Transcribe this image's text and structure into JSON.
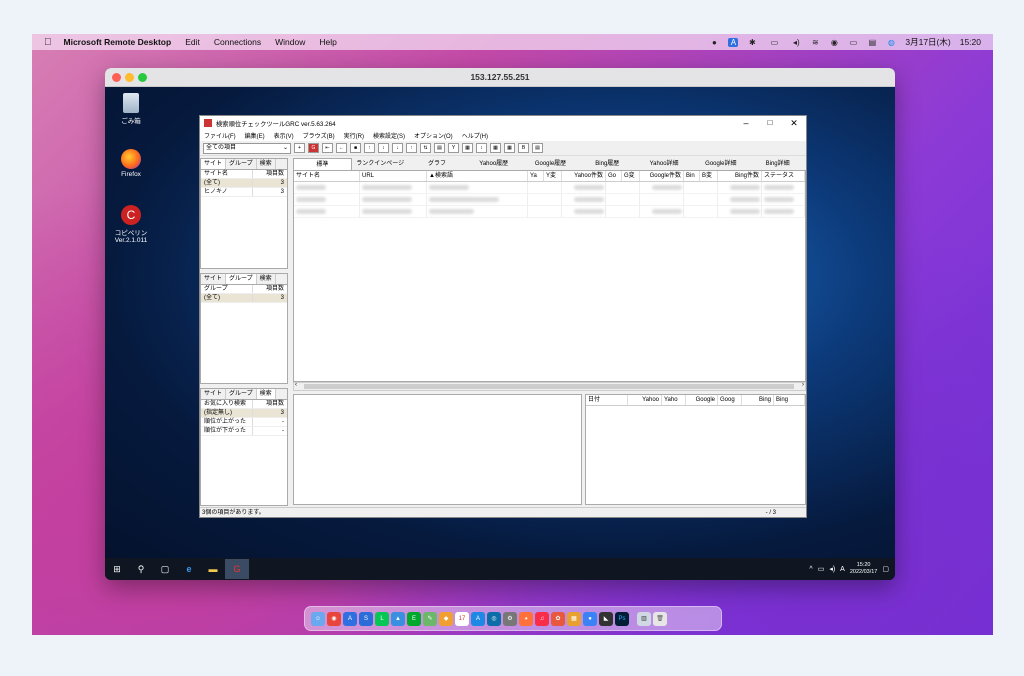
{
  "menubar": {
    "apple": "",
    "app": "Microsoft Remote Desktop",
    "items": [
      "Edit",
      "Connections",
      "Window",
      "Help"
    ],
    "date": "3月17日(木)",
    "time": "15:20"
  },
  "rd": {
    "title": "153.127.55.251"
  },
  "desktop_icons": [
    {
      "label": "ごみ箱"
    },
    {
      "label": "Firefox"
    },
    {
      "label": "コピペリン Ver.2.1.011"
    }
  ],
  "grc": {
    "title": "検索順位チェックツールGRC ver.5.63.264",
    "menu": [
      "ファイル(F)",
      "編集(E)",
      "表示(V)",
      "ブラウズ(B)",
      "実行(R)",
      "検索設定(S)",
      "オプション(O)",
      "ヘルプ(H)"
    ],
    "combo": "全ての項目",
    "panel1": {
      "tabs": [
        "サイト",
        "グループ",
        "検索"
      ],
      "headers": [
        "サイト名",
        "項目数"
      ],
      "rows": [
        [
          "(全て)",
          "3"
        ],
        [
          "ヒノキノ",
          "3"
        ]
      ]
    },
    "panel2": {
      "tabs": [
        "サイト",
        "グループ",
        "検索"
      ],
      "headers": [
        "グループ",
        "項目数"
      ],
      "rows": [
        [
          "(全て)",
          "3"
        ]
      ]
    },
    "panel3": {
      "tabs": [
        "サイト",
        "グループ",
        "検索"
      ],
      "headers": [
        "お気に入り検索",
        "項目数"
      ],
      "rows": [
        [
          "(指定無し)",
          "3"
        ],
        [
          "順位が上がった",
          "-"
        ],
        [
          "順位が下がった",
          "-"
        ]
      ]
    },
    "tabs": [
      "標準",
      "ランクインページ",
      "グラフ",
      "Yahoo履歴",
      "Google履歴",
      "Bing履歴",
      "Yahoo詳細",
      "Google詳細",
      "Bing詳細"
    ],
    "grid_headers": [
      "サイト名",
      "URL",
      "▲検索語",
      "Ya",
      "Y変",
      "Yahoo件数",
      "Go",
      "G変",
      "Google件数",
      "Bin",
      "B変",
      "Bing件数",
      "ステータス"
    ],
    "hist_headers": [
      "日付",
      "Yahoo",
      "Yaho",
      "Google",
      "Goog",
      "Bing",
      "Bing"
    ],
    "status": "3個の項目があります。",
    "page": "- / 3"
  },
  "taskbar": {
    "time": "15:20",
    "date": "2022/03/17",
    "ime": "A"
  }
}
